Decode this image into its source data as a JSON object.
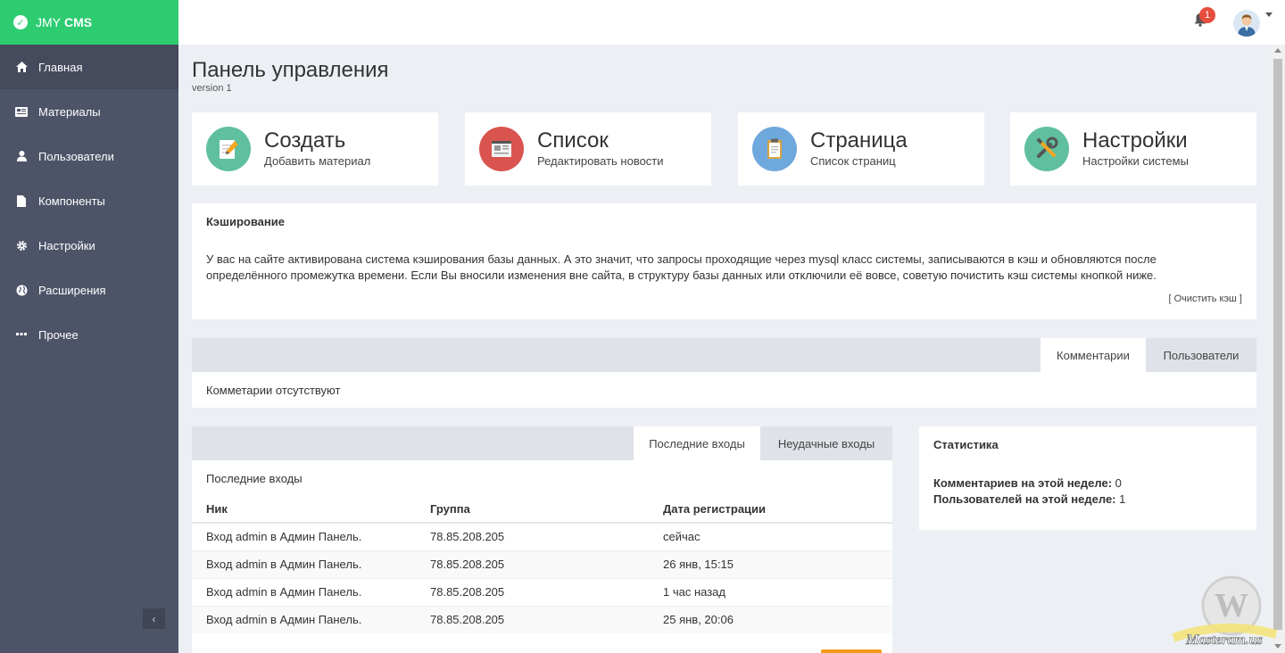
{
  "brand": {
    "name_prefix": "JMY",
    "name_suffix": "CMS"
  },
  "sidebar": {
    "items": [
      {
        "label": "Главная",
        "icon": "home-icon"
      },
      {
        "label": "Материалы",
        "icon": "newspaper-icon"
      },
      {
        "label": "Пользователи",
        "icon": "user-icon"
      },
      {
        "label": "Компоненты",
        "icon": "file-icon"
      },
      {
        "label": "Настройки",
        "icon": "gear-icon"
      },
      {
        "label": "Расширения",
        "icon": "globe-icon"
      },
      {
        "label": "Прочее",
        "icon": "ellipsis-icon"
      }
    ],
    "collapse_label": "‹"
  },
  "header": {
    "notification_count": "1"
  },
  "page": {
    "title": "Панель управления",
    "subtitle": "version 1"
  },
  "tiles": [
    {
      "title": "Создать",
      "subtitle": "Добавить материал",
      "color": "#5fbf9f"
    },
    {
      "title": "Список",
      "subtitle": "Редактировать новости",
      "color": "#d9534f"
    },
    {
      "title": "Страница",
      "subtitle": "Список страниц",
      "color": "#6fa8dc"
    },
    {
      "title": "Настройки",
      "subtitle": "Настройки системы",
      "color": "#5fbf9f"
    }
  ],
  "cache": {
    "title": "Кэширование",
    "text": "У вас на сайте активирована система кэширования базы данных. А это значит, что запросы проходящие через mysql класс системы, записываются в кэш и обновляются после определённого промежутка времени. Если Вы вносили изменения вне сайта, в структуру базы данных или отключили её вовсе, советую почистить кэш системы кнопкой ниже.",
    "clear_link": "[ Очистить кэш ]"
  },
  "comments_panel": {
    "tabs": [
      "Комментарии",
      "Пользователи"
    ],
    "empty_text": "Комметарии отсутствуют"
  },
  "logins_panel": {
    "tabs": [
      "Последние входы",
      "Неудачные входы"
    ],
    "heading": "Последние входы",
    "columns": [
      "Ник",
      "Группа",
      "Дата регистрации"
    ],
    "rows": [
      [
        "Вход admin в Админ Панель.",
        "78.85.208.205",
        "сейчас"
      ],
      [
        "Вход admin в Админ Панель.",
        "78.85.208.205",
        "26 янв, 15:15"
      ],
      [
        "Вход admin в Админ Панель.",
        "78.85.208.205",
        "1 час назад"
      ],
      [
        "Вход admin в Админ Панель.",
        "78.85.208.205",
        "25 янв, 20:06"
      ]
    ]
  },
  "stats": {
    "title": "Статистика",
    "comments_label": "Комментариев на этой неделе:",
    "comments_value": "0",
    "users_label": "Пользователей на этой неделе:",
    "users_value": "1"
  },
  "watermark": {
    "text": "Masteram.us"
  },
  "colors": {
    "brand_green": "#2ecc71",
    "sidebar": "#4e5468",
    "badge_red": "#e74c3c"
  }
}
